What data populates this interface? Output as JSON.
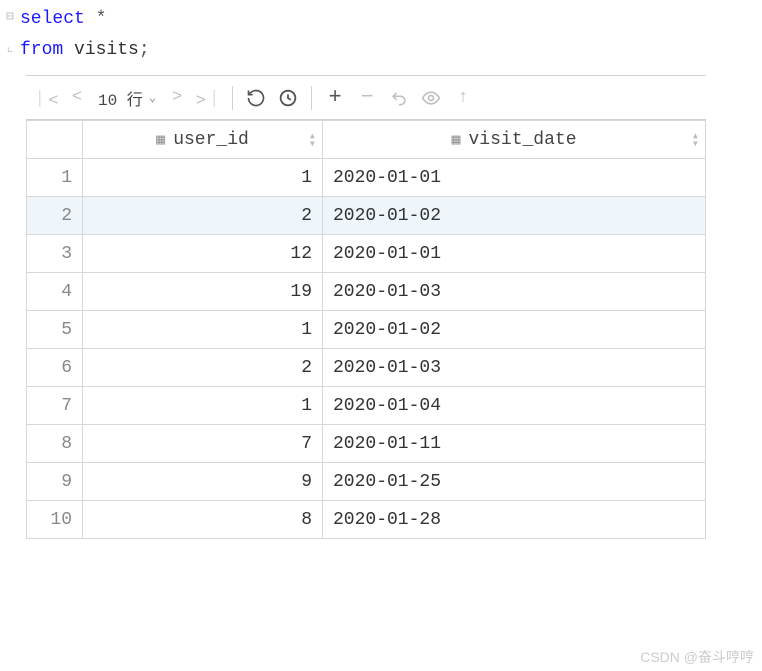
{
  "editor": {
    "line1_keyword": "select",
    "line1_rest": " *",
    "line2_keyword": "from",
    "line2_rest": " visits",
    "line2_semi": ";"
  },
  "toolbar": {
    "row_label": "10 行"
  },
  "table": {
    "columns": [
      "user_id",
      "visit_date"
    ],
    "rows": [
      {
        "n": "1",
        "user_id": "1",
        "visit_date": "2020-01-01"
      },
      {
        "n": "2",
        "user_id": "2",
        "visit_date": "2020-01-02"
      },
      {
        "n": "3",
        "user_id": "12",
        "visit_date": "2020-01-01"
      },
      {
        "n": "4",
        "user_id": "19",
        "visit_date": "2020-01-03"
      },
      {
        "n": "5",
        "user_id": "1",
        "visit_date": "2020-01-02"
      },
      {
        "n": "6",
        "user_id": "2",
        "visit_date": "2020-01-03"
      },
      {
        "n": "7",
        "user_id": "1",
        "visit_date": "2020-01-04"
      },
      {
        "n": "8",
        "user_id": "7",
        "visit_date": "2020-01-11"
      },
      {
        "n": "9",
        "user_id": "9",
        "visit_date": "2020-01-25"
      },
      {
        "n": "10",
        "user_id": "8",
        "visit_date": "2020-01-28"
      }
    ]
  },
  "watermark": "CSDN @奋斗哼哼",
  "chart_data": {
    "type": "table",
    "title": "visits",
    "columns": [
      "user_id",
      "visit_date"
    ],
    "rows": [
      [
        1,
        "2020-01-01"
      ],
      [
        2,
        "2020-01-02"
      ],
      [
        12,
        "2020-01-01"
      ],
      [
        19,
        "2020-01-03"
      ],
      [
        1,
        "2020-01-02"
      ],
      [
        2,
        "2020-01-03"
      ],
      [
        1,
        "2020-01-04"
      ],
      [
        7,
        "2020-01-11"
      ],
      [
        9,
        "2020-01-25"
      ],
      [
        8,
        "2020-01-28"
      ]
    ]
  }
}
